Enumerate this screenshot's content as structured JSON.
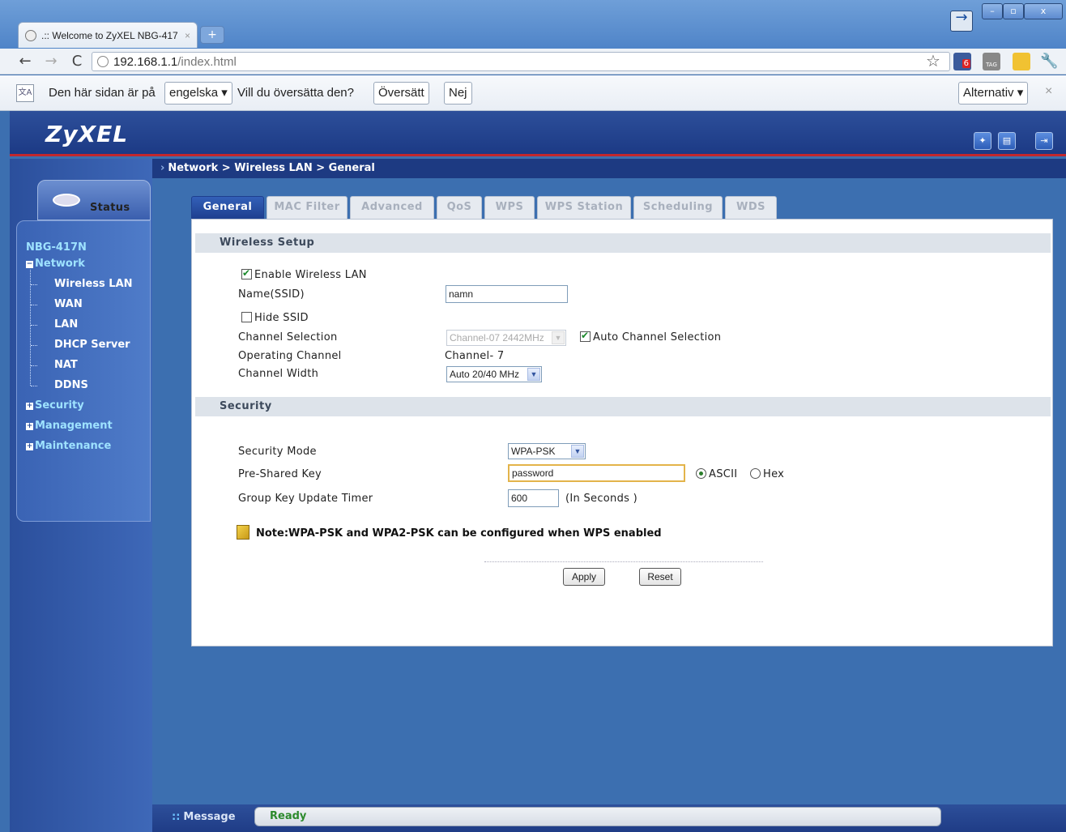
{
  "browser": {
    "tab_title": ".:: Welcome to ZyXEL NBG-417",
    "tab_close": "×",
    "new_tab": "+",
    "url_host": "192.168.1.1",
    "url_path": "/index.html",
    "ext_badge": "6",
    "ext_tag": "TAG"
  },
  "translate_bar": {
    "prefix": "Den här sidan är på",
    "language": "engelska ▾",
    "question": "Vill du översätta den?",
    "translate_button": "Översätt",
    "no_button": "Nej",
    "options_button": "Alternativ ▾",
    "close": "×"
  },
  "app": {
    "logo": "ZyXEL",
    "breadcrumb": "Network > Wireless LAN > General",
    "status_label": "Status"
  },
  "sidebar": {
    "device": "NBG-417N",
    "network": "Network",
    "items": [
      "Wireless LAN",
      "WAN",
      "LAN",
      "DHCP Server",
      "NAT",
      "DDNS"
    ],
    "security": "Security",
    "management": "Management",
    "maintenance": "Maintenance"
  },
  "tabs": [
    "General",
    "MAC Filter",
    "Advanced",
    "QoS",
    "WPS",
    "WPS Station",
    "Scheduling",
    "WDS"
  ],
  "wireless_setup": {
    "header": "Wireless Setup",
    "enable_label": "Enable Wireless LAN",
    "ssid_label": "Name(SSID)",
    "ssid_value": "namn",
    "hide_ssid_label": "Hide SSID",
    "channel_selection_label": "Channel Selection",
    "channel_selection_value": "Channel-07 2442MHz",
    "auto_channel_label": "Auto Channel Selection",
    "operating_channel_label": "Operating Channel",
    "operating_channel_value": "Channel- 7",
    "channel_width_label": "Channel Width",
    "channel_width_value": "Auto 20/40 MHz"
  },
  "security": {
    "header": "Security",
    "mode_label": "Security Mode",
    "mode_value": "WPA-PSK",
    "psk_label": "Pre-Shared Key",
    "psk_value": "password",
    "ascii_label": "ASCII",
    "hex_label": "Hex",
    "timer_label": "Group Key Update Timer",
    "timer_value": "600",
    "timer_unit": "(In Seconds )",
    "note": "Note:WPA-PSK and WPA2-PSK can be configured when WPS enabled"
  },
  "actions": {
    "apply": "Apply",
    "reset": "Reset"
  },
  "statusbar": {
    "message_label": "Message",
    "status": "Ready",
    "dots": "::"
  }
}
